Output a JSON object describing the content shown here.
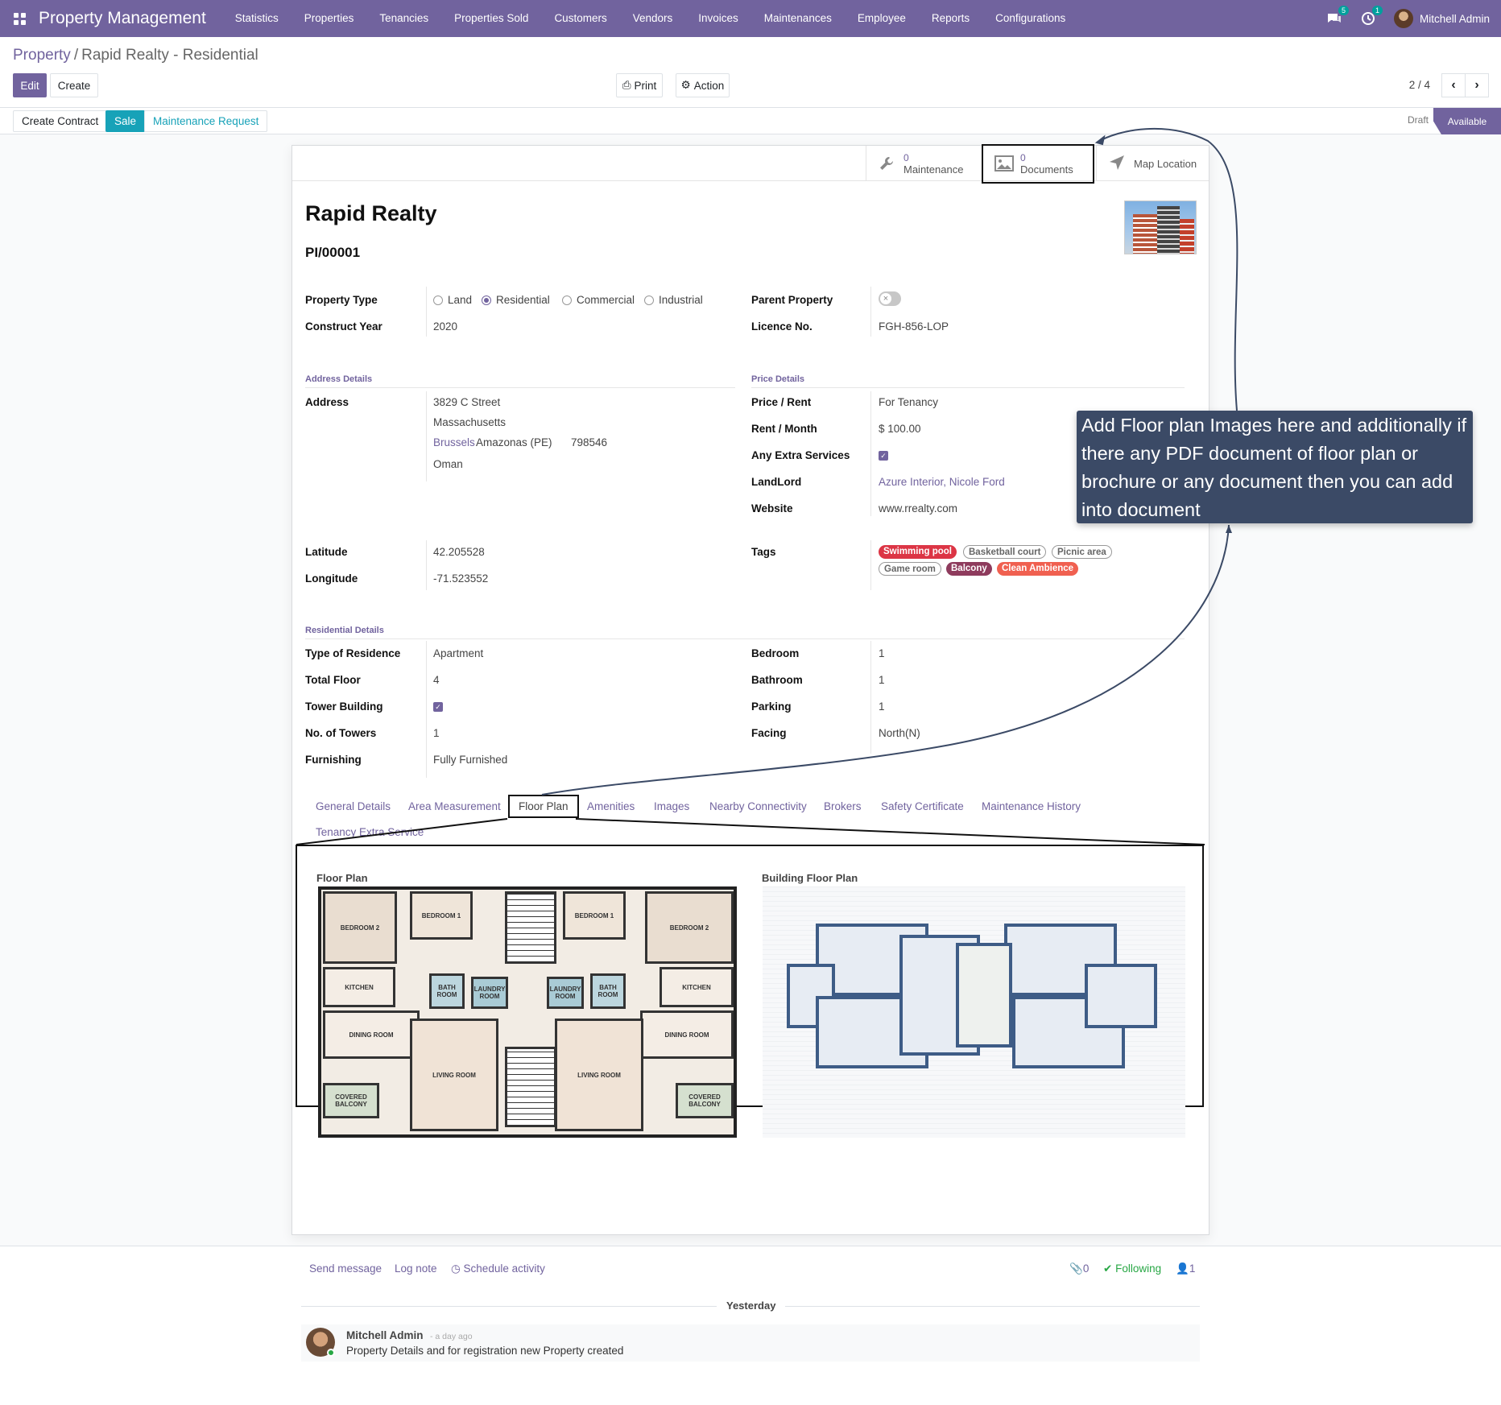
{
  "navbar": {
    "brand": "Property Management",
    "menu": [
      "Statistics",
      "Properties",
      "Tenancies",
      "Properties Sold",
      "Customers",
      "Vendors",
      "Invoices",
      "Maintenances",
      "Employee",
      "Reports",
      "Configurations"
    ],
    "messages_count": "5",
    "activities_count": "1",
    "user": "Mitchell Admin"
  },
  "breadcrumb": {
    "parent": "Property",
    "sep": "/",
    "current": "Rapid Realty - Residential"
  },
  "control": {
    "edit": "Edit",
    "create": "Create",
    "print": "Print",
    "action": "Action",
    "pager": "2 / 4"
  },
  "statusbar": {
    "create_contract": "Create Contract",
    "sale": "Sale",
    "maintenance_request": "Maintenance Request",
    "stage_draft": "Draft",
    "stage_available": "Available"
  },
  "smart_buttons": {
    "maintenance": {
      "count": "0",
      "label": "Maintenance"
    },
    "documents": {
      "count": "0",
      "label": "Documents"
    },
    "map": {
      "label": "Map Location"
    }
  },
  "record": {
    "name": "Rapid Realty",
    "ref": "PI/00001"
  },
  "general": {
    "property_type_label": "Property Type",
    "types": [
      "Land",
      "Residential",
      "Commercial",
      "Industrial"
    ],
    "selected_type": "Residential",
    "construct_year_label": "Construct Year",
    "construct_year": "2020",
    "parent_property_label": "Parent Property",
    "licence_label": "Licence No.",
    "licence": "FGH-856-LOP"
  },
  "address": {
    "section": "Address Details",
    "label": "Address",
    "street": "3829 C Street",
    "street2": "Massachusetts",
    "city": "Brussels",
    "state": "Amazonas (PE)",
    "zip": "798546",
    "country": "Oman",
    "latitude_label": "Latitude",
    "latitude": "42.205528",
    "longitude_label": "Longitude",
    "longitude": "-71.523552"
  },
  "price": {
    "section": "Price Details",
    "price_rent_label": "Price / Rent",
    "price_rent": "For Tenancy",
    "rent_month_label": "Rent / Month",
    "rent_month": "$ 100.00",
    "extra_label": "Any Extra Services",
    "landlord_label": "LandLord",
    "landlord": "Azure Interior, Nicole Ford",
    "website_label": "Website",
    "website": "www.rrealty.com",
    "tags_label": "Tags",
    "tags": [
      {
        "name": "Swimming pool",
        "color": "#dc3545"
      },
      {
        "name": "Basketball court",
        "color": ""
      },
      {
        "name": "Picnic area",
        "color": ""
      },
      {
        "name": "Game room",
        "color": ""
      },
      {
        "name": "Balcony",
        "color": "#8e3b5d"
      },
      {
        "name": "Clean Ambience",
        "color": "#f06050"
      }
    ]
  },
  "residential": {
    "section": "Residential Details",
    "type_label": "Type of Residence",
    "type": "Apartment",
    "floor_label": "Total Floor",
    "floor": "4",
    "tower_label": "Tower Building",
    "towers_label": "No. of Towers",
    "towers": "1",
    "furnishing_label": "Furnishing",
    "furnishing": "Fully Furnished",
    "bedroom_label": "Bedroom",
    "bedroom": "1",
    "bathroom_label": "Bathroom",
    "bathroom": "1",
    "parking_label": "Parking",
    "parking": "1",
    "facing_label": "Facing",
    "facing": "North(N)"
  },
  "tabs": [
    "General Details",
    "Area Measurement",
    "Floor Plan",
    "Amenities",
    "Images",
    "Nearby Connectivity",
    "Brokers",
    "Safety Certificate",
    "Maintenance History",
    "Tenancy Extra Service"
  ],
  "active_tab": "Floor Plan",
  "floor_plan": {
    "left_title": "Floor Plan",
    "right_title": "Building Floor Plan",
    "rooms": [
      "BEDROOM 2",
      "BEDROOM 1",
      "BEDROOM 1",
      "BEDROOM 2",
      "KITCHEN",
      "KITCHEN",
      "BATH ROOM",
      "LAUNDRY ROOM",
      "LAUNDRY ROOM",
      "BATH ROOM",
      "DINING ROOM",
      "DINING ROOM",
      "LIVING ROOM",
      "LIVING ROOM",
      "COVERED BALCONY",
      "COVERED BALCONY"
    ]
  },
  "callout": "Add Floor plan Images here and additionally if there any PDF document of floor plan or brochure or any document then you can add into document",
  "chatter": {
    "send_message": "Send message",
    "log_note": "Log note",
    "schedule": "Schedule activity",
    "attachments": "0",
    "following": "Following",
    "followers": "1",
    "day": "Yesterday",
    "author": "Mitchell Admin",
    "time": "- a day ago",
    "body": "Property Details and for registration new Property created"
  },
  "colors": {
    "brand": "#71639e",
    "teal": "#17a2b8",
    "callout": "#3b4a66"
  }
}
